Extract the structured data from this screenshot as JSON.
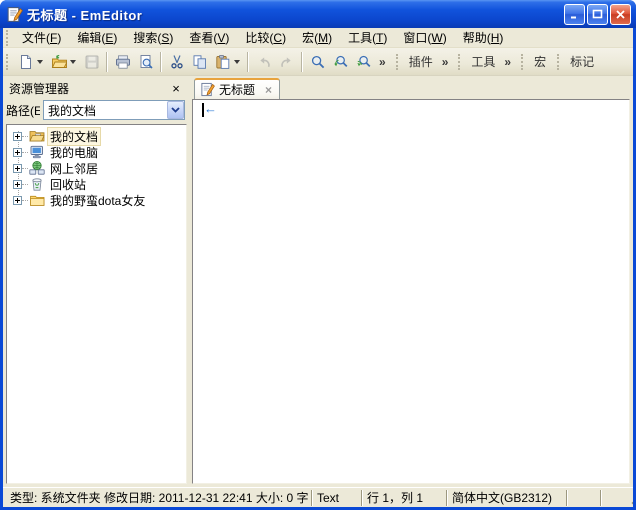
{
  "window": {
    "title": "无标题 - EmEditor"
  },
  "menu_bar": {
    "items": [
      {
        "id": "file",
        "label": "文件(F)"
      },
      {
        "id": "edit",
        "label": "编辑(E)"
      },
      {
        "id": "search",
        "label": "搜索(S)"
      },
      {
        "id": "view",
        "label": "查看(V)"
      },
      {
        "id": "compare",
        "label": "比较(C)"
      },
      {
        "id": "macros",
        "label": "宏(M)"
      },
      {
        "id": "tools",
        "label": "工具(T)"
      },
      {
        "id": "window",
        "label": "窗口(W)"
      },
      {
        "id": "help",
        "label": "帮助(H)"
      }
    ]
  },
  "toolbar": {
    "overflow_glyph": "»",
    "groups": [
      {
        "id": "plugins",
        "label": "插件",
        "overflow": "»"
      },
      {
        "id": "tools",
        "label": "工具",
        "overflow": "»"
      },
      {
        "id": "macros",
        "label": "宏",
        "overflow": ""
      },
      {
        "id": "marks",
        "label": "标记",
        "overflow": ""
      }
    ]
  },
  "sidebar": {
    "title": "资源管理器",
    "close_glyph": "×",
    "path_label": "路径(E",
    "path_value": "我的文档",
    "tree": [
      {
        "label": "我的文档",
        "icon": "my-documents",
        "selected": true
      },
      {
        "label": "我的电脑",
        "icon": "my-computer",
        "selected": false
      },
      {
        "label": "网上邻居",
        "icon": "network",
        "selected": false
      },
      {
        "label": "回收站",
        "icon": "recycle-bin",
        "selected": false
      },
      {
        "label": "我的野蛮dota女友",
        "icon": "folder",
        "selected": false
      }
    ]
  },
  "editor": {
    "tab": {
      "label": "无标题",
      "close_glyph": "×"
    },
    "eof_marker": "←"
  },
  "status_bar": {
    "segments": [
      "类型: 系统文件夹 修改日期: 2011-12-31 22:41 大小: 0 字",
      "Text",
      "行 1，列 1",
      "简体中文(GB2312)",
      "",
      ""
    ]
  },
  "colors": {
    "titlebar_blue": "#0B45CC",
    "frame_blue": "#0A49D6",
    "client_tan": "#ECE9D8",
    "active_tab_accent": "#E8A33D",
    "eof_marker_blue": "#2F7BD6",
    "close_button_red": "#E0553A"
  }
}
